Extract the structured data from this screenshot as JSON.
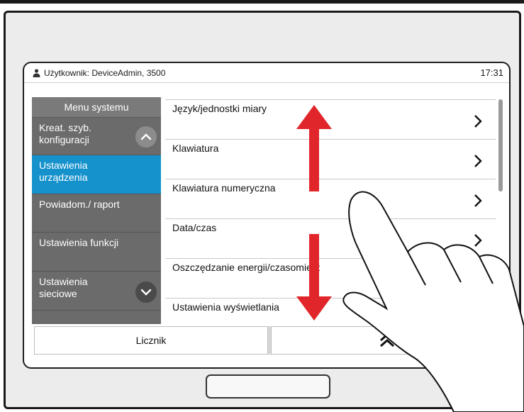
{
  "statusbar": {
    "user": "Użytkownik: DeviceAdmin, 3500",
    "time": "17:31"
  },
  "sidebar": {
    "title": "Menu systemu",
    "items": [
      {
        "label": "Kreat. szyb. konfiguracji"
      },
      {
        "label": "Ustawienia urządzenia",
        "active": true
      },
      {
        "label": "Powiadom./ raport"
      },
      {
        "label": "Ustawienia funkcji"
      },
      {
        "label": "Ustawienia sieciowe"
      }
    ]
  },
  "list": {
    "items": [
      {
        "label": "Język/jednostki miary"
      },
      {
        "label": "Klawiatura"
      },
      {
        "label": "Klawiatura numeryczna"
      },
      {
        "label": "Data/czas"
      },
      {
        "label": "Oszczędzanie energii/czasomierz"
      },
      {
        "label": "Ustawienia wyświetlania"
      }
    ]
  },
  "bottom": {
    "counter_label": "Licznik"
  },
  "colors": {
    "active": "#1591cc",
    "sidebar": "#6b6b6b",
    "arrow": "#e1262b"
  },
  "icons": [
    "user-icon",
    "chevron-right-icon",
    "chevron-up-icon",
    "chevron-down-icon",
    "double-chevron-up-icon",
    "swipe-arrow-icon",
    "hand-icon"
  ]
}
